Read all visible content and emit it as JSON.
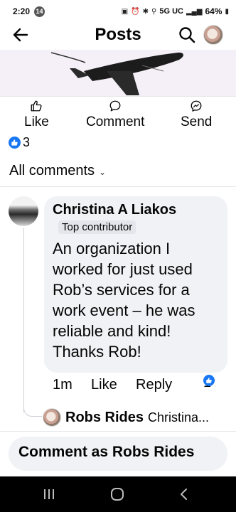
{
  "status_bar": {
    "time": "2:20",
    "notification_count": "14",
    "network": "5G UC",
    "battery": "64%"
  },
  "header": {
    "title": "Posts"
  },
  "post_actions": {
    "like_label": "Like",
    "comment_label": "Comment",
    "send_label": "Send"
  },
  "reactions": {
    "count": "3"
  },
  "comments_filter": {
    "label": "All comments"
  },
  "comment": {
    "author": "Christina A Liakos",
    "badge": "Top contributor",
    "text": "An organization I worked for just used Rob’s services for a work event – he was reliable and kind! Thanks Rob!",
    "time": "1m",
    "like_label": "Like",
    "reply_label": "Reply",
    "reaction_count": "1"
  },
  "reply_preview": {
    "author": "Robs Rides",
    "snippet": "Christina..."
  },
  "composer": {
    "placeholder": "Comment as Robs Rides"
  },
  "colors": {
    "accent": "#1877f2",
    "bubble": "#f0f2f5",
    "text": "#050505",
    "nav_bar": "#000000"
  }
}
